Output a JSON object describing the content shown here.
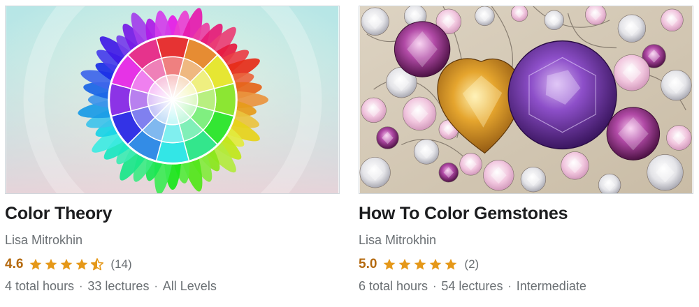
{
  "courses": [
    {
      "title": "Color Theory",
      "instructor": "Lisa Mitrokhin",
      "rating": "4.6",
      "rating_fraction": 0.92,
      "reviews": "(14)",
      "hours": "4 total hours",
      "lectures": "33 lectures",
      "level": "All Levels",
      "image_subject": "color-wheel-flower-image"
    },
    {
      "title": "How To Color Gemstones",
      "instructor": "Lisa Mitrokhin",
      "rating": "5.0",
      "rating_fraction": 1.0,
      "reviews": "(2)",
      "hours": "6 total hours",
      "lectures": "54 lectures",
      "level": "Intermediate",
      "image_subject": "gemstones-illustration-image"
    }
  ],
  "separator": "·",
  "colors": {
    "title": "#1c1d1f",
    "muted": "#6a6f73",
    "rating": "#b4690e",
    "star": "#e59819"
  },
  "icons": {
    "star": "star-icon",
    "half_star": "star-half-icon"
  }
}
